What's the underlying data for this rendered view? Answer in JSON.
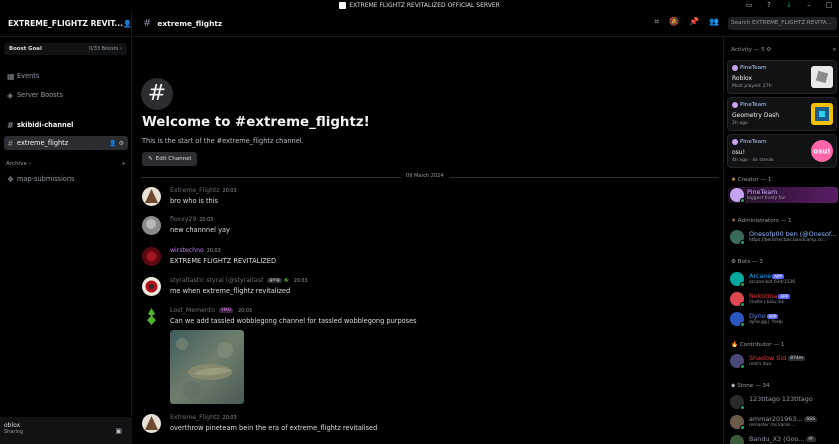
{
  "window": {
    "title": "EXTREME FLIGHTZ REVITALIZED OFFICIAL SERVER"
  },
  "server": {
    "name": "EXTREME_FLIGHTZ REVIT...",
    "boost_goal_label": "Boost Goal",
    "boost_count": "0/33 Boosts"
  },
  "sidebar": {
    "events": "Events",
    "server_boosts": "Server Boosts",
    "channels": [
      {
        "name": "skibidi-channel"
      },
      {
        "name": "extreme_flightz"
      }
    ],
    "archive_label": "Archive",
    "archive_channels": [
      {
        "name": "map-submissions"
      }
    ]
  },
  "userbar": {
    "activity": "oblox",
    "status": "Sharing"
  },
  "header": {
    "channel": "extreme_flightz",
    "search_placeholder": "Search EXTREME_FLIGHTZ REVITA..."
  },
  "welcome": {
    "title": "Welcome to #extreme_flightz!",
    "subtitle": "This is the start of the #extreme_flightz channel.",
    "edit_button": "Edit Channel"
  },
  "date_divider": "09 March 2024",
  "messages": [
    {
      "author": "Extreme_Flightz",
      "time": "20:03",
      "text": "bro who is this",
      "color": "#6d6f78"
    },
    {
      "author": "floxxy29",
      "time": "20:03",
      "text": "new channnel yay",
      "color": "#6d6f78"
    },
    {
      "author": "wirstechno",
      "time": "20:03",
      "text": "EXTREME FLIGHTZ REVITALIZED",
      "color": "#c77dff"
    },
    {
      "author": "styraltastic styral (@styraltast",
      "time": "20:03",
      "text": "me when extreme_flightz revitalized",
      "tag": "gmg",
      "color": "#6d6f78"
    },
    {
      "author": "Lost_Memento",
      "time": "20:03",
      "text": "Can we add tassled wobblegong channel for tassled wobblegong purposes",
      "tag": "YMO",
      "color": "#6d6f78"
    },
    {
      "author": "Extreme_Flightz",
      "time": "20:03",
      "text": "overthrow pineteam bein the era of extreme_flightz revitalised",
      "color": "#6d6f78"
    }
  ],
  "members": {
    "activity_header": "Activity — 5",
    "activity_cards": [
      {
        "user": "PineTeam",
        "game": "Roblox",
        "status": "Most played: 27h"
      },
      {
        "user": "PineTeam",
        "game": "Geometry Dash",
        "status": "2h ago"
      },
      {
        "user": "PineTeam",
        "game": "osu!",
        "status": "4h ago · 4x streak"
      }
    ],
    "creator_header": "Creator — 1",
    "creator": {
      "name": "PineTeam",
      "status": "biggest frosty fan"
    },
    "admins_header": "Administrators — 1",
    "admin": {
      "name": "Onesofp00 ben (@Onesof...",
      "status": "https://bensfrectals.bandcamp.co..."
    },
    "bots_header": "Bots — 3",
    "bots": [
      {
        "name": "Arcane",
        "status": "arcane.bot 634/1536",
        "color": "#00a8fc"
      },
      {
        "name": "Nekotina",
        "status": "/invite | bizu.ink",
        "color": "#da373c"
      },
      {
        "name": "Dyno",
        "status": "dyno.gg | ?help",
        "color": "#5b8af0"
      }
    ],
    "app_badge": "APP",
    "contributor_header": "Contributor — 1",
    "contributor": {
      "name": "Shadow Sid",
      "status": "rent's due",
      "badge": "874m"
    },
    "stone_header": "Stone — 34",
    "stone": [
      {
        "name": "123titago 123titago",
        "status": ""
      },
      {
        "name": "ammar201963...",
        "status": "remaster ms.karan ...",
        "badge": "SSS"
      },
      {
        "name": "Bandu_X3 (Goo...",
        "status": "",
        "badge": "PF"
      }
    ]
  }
}
